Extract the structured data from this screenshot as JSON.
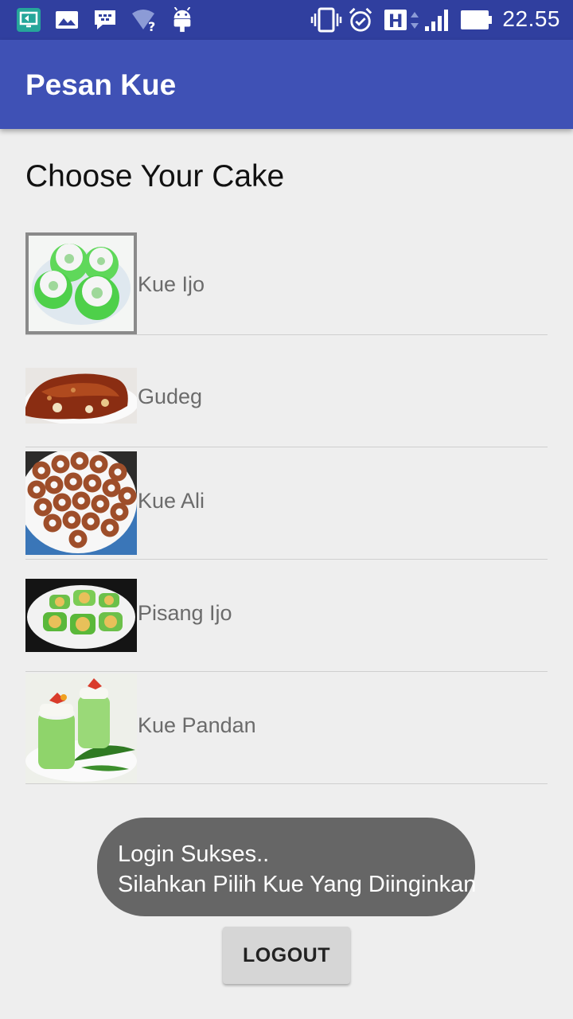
{
  "statusbar": {
    "time": "22.55",
    "left_icons": [
      "screen-cast-icon",
      "gallery-icon",
      "bbm-icon",
      "wifi-unknown-icon",
      "android-icon"
    ],
    "right_icons": [
      "vibrate-icon",
      "alarm-icon",
      "hspa-icon",
      "signal-icon",
      "battery-icon"
    ],
    "network_type": "H"
  },
  "appbar": {
    "title": "Pesan Kue"
  },
  "main": {
    "heading": "Choose Your Cake",
    "items": [
      {
        "label": "Kue Ijo"
      },
      {
        "label": "Gudeg"
      },
      {
        "label": "Kue Ali"
      },
      {
        "label": "Pisang Ijo"
      },
      {
        "label": "Kue Pandan"
      }
    ],
    "logout_label": "LOGOUT"
  },
  "toast": {
    "line1": "Login Sukses..",
    "line2": "Silahkan Pilih Kue Yang Diinginkan"
  },
  "colors": {
    "status_bar": "#303f9f",
    "app_bar": "#3f51b5",
    "background": "#eeeeee",
    "toast_bg": "#666666",
    "button_bg": "#d6d6d6"
  }
}
